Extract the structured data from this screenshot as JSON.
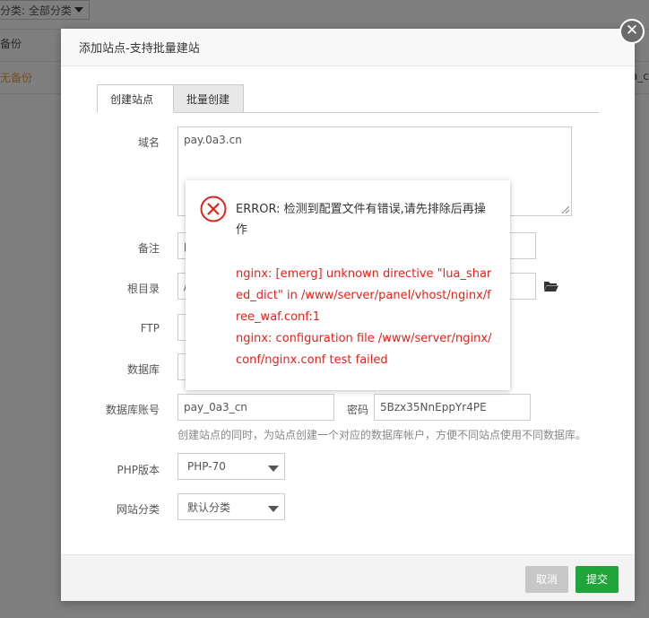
{
  "background": {
    "filter_label": "分类: 全部分类",
    "row1_text": "备份",
    "row2_text": "无备份",
    "right_text": "a_c"
  },
  "modal": {
    "title": "添加站点-支持批量建站",
    "close_symbol": "✕",
    "tabs": [
      {
        "label": "创建站点"
      },
      {
        "label": "批量创建"
      }
    ],
    "fields": {
      "domain_label": "域名",
      "domain_value": "pay.0a3.cn",
      "remark_label": "备注",
      "remark_value": "p",
      "root_label": "根目录",
      "root_value": "/",
      "ftp_label": "FTP",
      "db_label": "数据库",
      "db_account_label": "数据库账号",
      "db_account_value": "pay_0a3_cn",
      "password_label": "密码",
      "password_value": "5Bzx35NnEppYr4PE",
      "db_hint": "创建站点的同时，为站点创建一个对应的数据库帐户，方便不同站点使用不同数据库。",
      "php_label": "PHP版本",
      "php_value": "PHP-70",
      "category_label": "网站分类",
      "category_value": "默认分类"
    },
    "buttons": {
      "cancel": "取消",
      "submit": "提交"
    }
  },
  "error": {
    "title": "ERROR: 检测到配置文件有错误,请先排除后再操作",
    "detail_line1": "nginx: [emerg] unknown directive \"lua_shared_dict\" in /www/server/panel/vhost/nginx/free_waf.conf:1",
    "detail_line2": "nginx: configuration file /www/server/nginx/conf/nginx.conf test failed",
    "colors": {
      "icon": "#e2231a",
      "text": "#e2231a"
    }
  }
}
